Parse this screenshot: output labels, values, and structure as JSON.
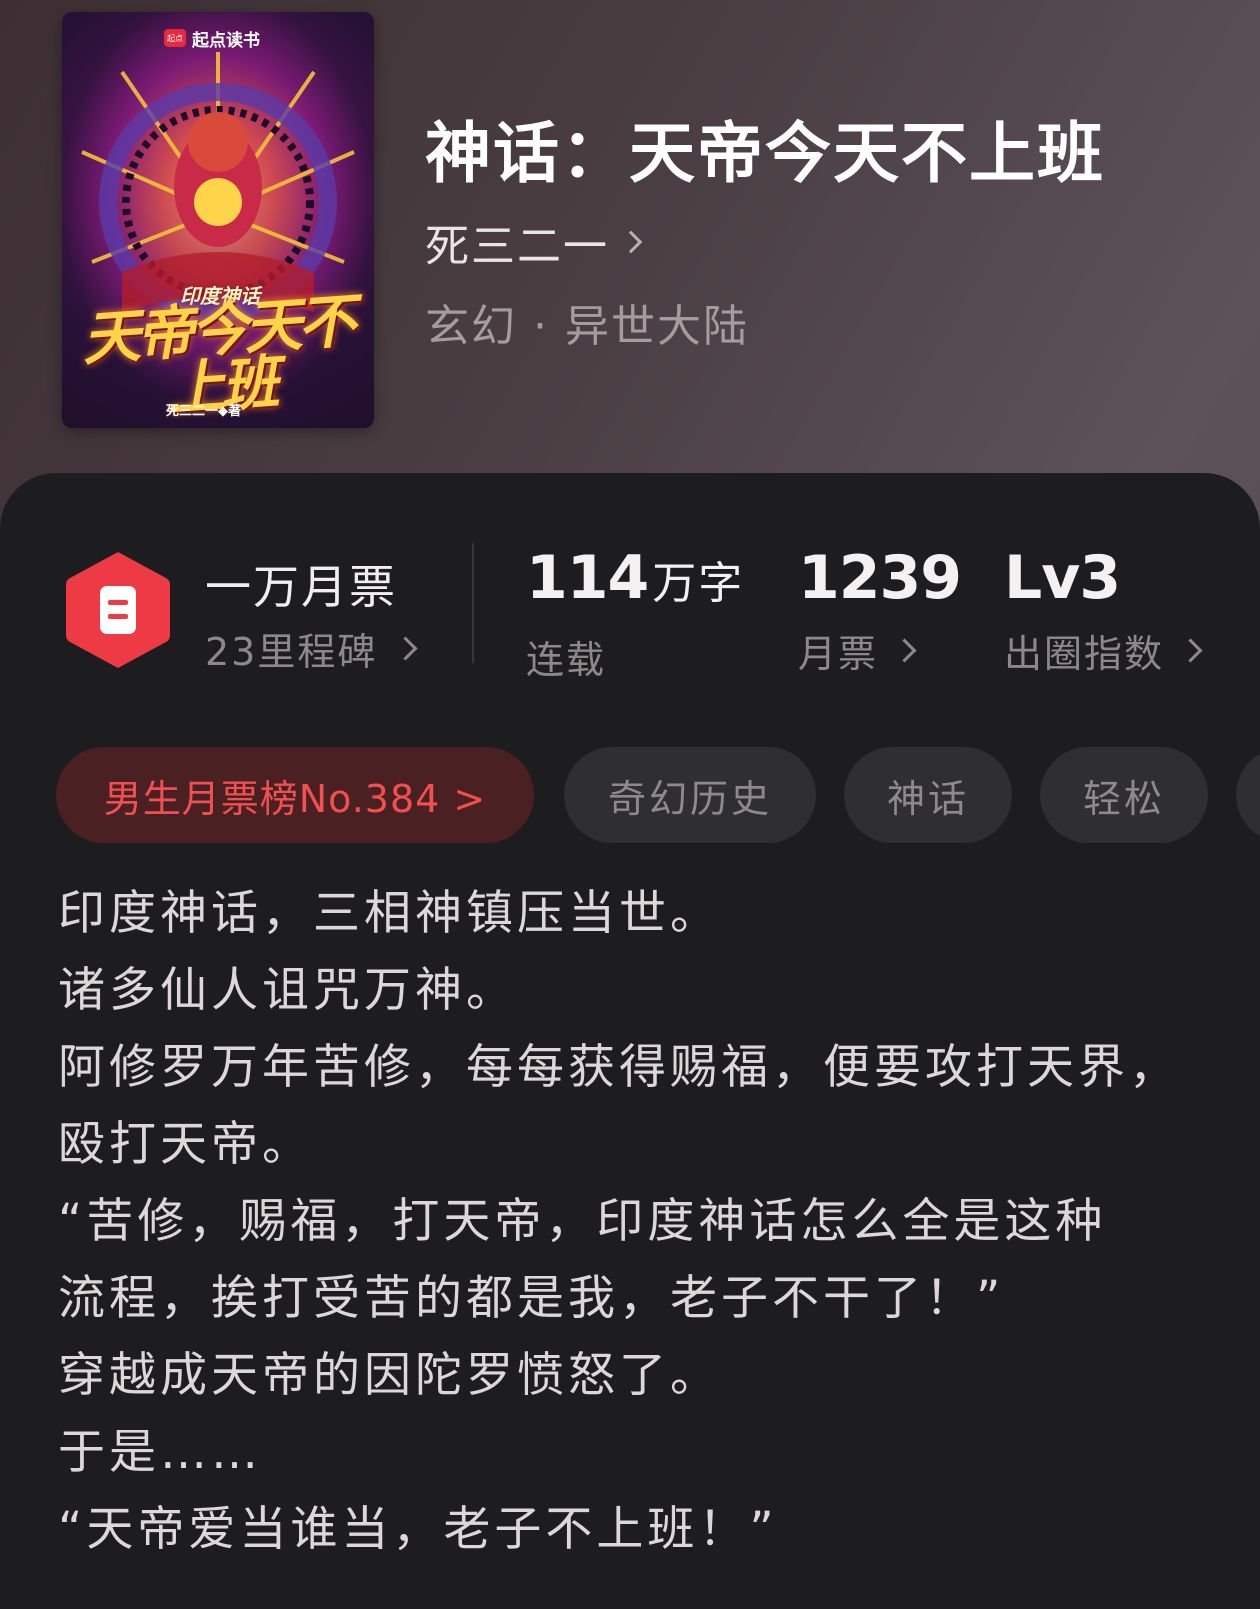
{
  "cover": {
    "brand_badge": "起点",
    "brand": "起点读书",
    "subtitle": "印度神话",
    "title": "天帝今天不上班",
    "author_credit": "死三二一◆著"
  },
  "book": {
    "title": "神话：天帝今天不上班",
    "author": "死三二一",
    "genre": "玄幻 · 异世大陆"
  },
  "stats": {
    "ticket_main": "一万月票",
    "ticket_sub": "23里程碑",
    "words_value": "114",
    "words_unit": "万字",
    "words_label": "连载",
    "monthly_value": "1239",
    "monthly_label": "月票",
    "level_value": "Lv3",
    "level_label": "出圈指数"
  },
  "tags": [
    "男生月票榜No.384 >",
    "奇幻历史",
    "神话",
    "轻松"
  ],
  "description": [
    "印度神话，三相神镇压当世。",
    "诸多仙人诅咒万神。",
    "阿修罗万年苦修，每每获得赐福，便要攻打天界，",
    "殴打天帝。",
    "“苦修，赐福，打天帝，印度神话怎么全是这种",
    "流程，挨打受苦的都是我，老子不干了！”",
    "穿越成天帝的因陀罗愤怒了。",
    "于是……",
    "“天帝爱当谁当，老子不上班！”"
  ],
  "colors": {
    "accent_red": "#f0504f",
    "hex_icon": "#ee3a44",
    "card_bg": "#1d1c1e",
    "tag_bg": "#2f2e31",
    "rank_tag_bg": "#4a2022"
  },
  "icons": {
    "ticket": "ticket-hexagon-icon",
    "chevron": "chevron-right-icon"
  }
}
